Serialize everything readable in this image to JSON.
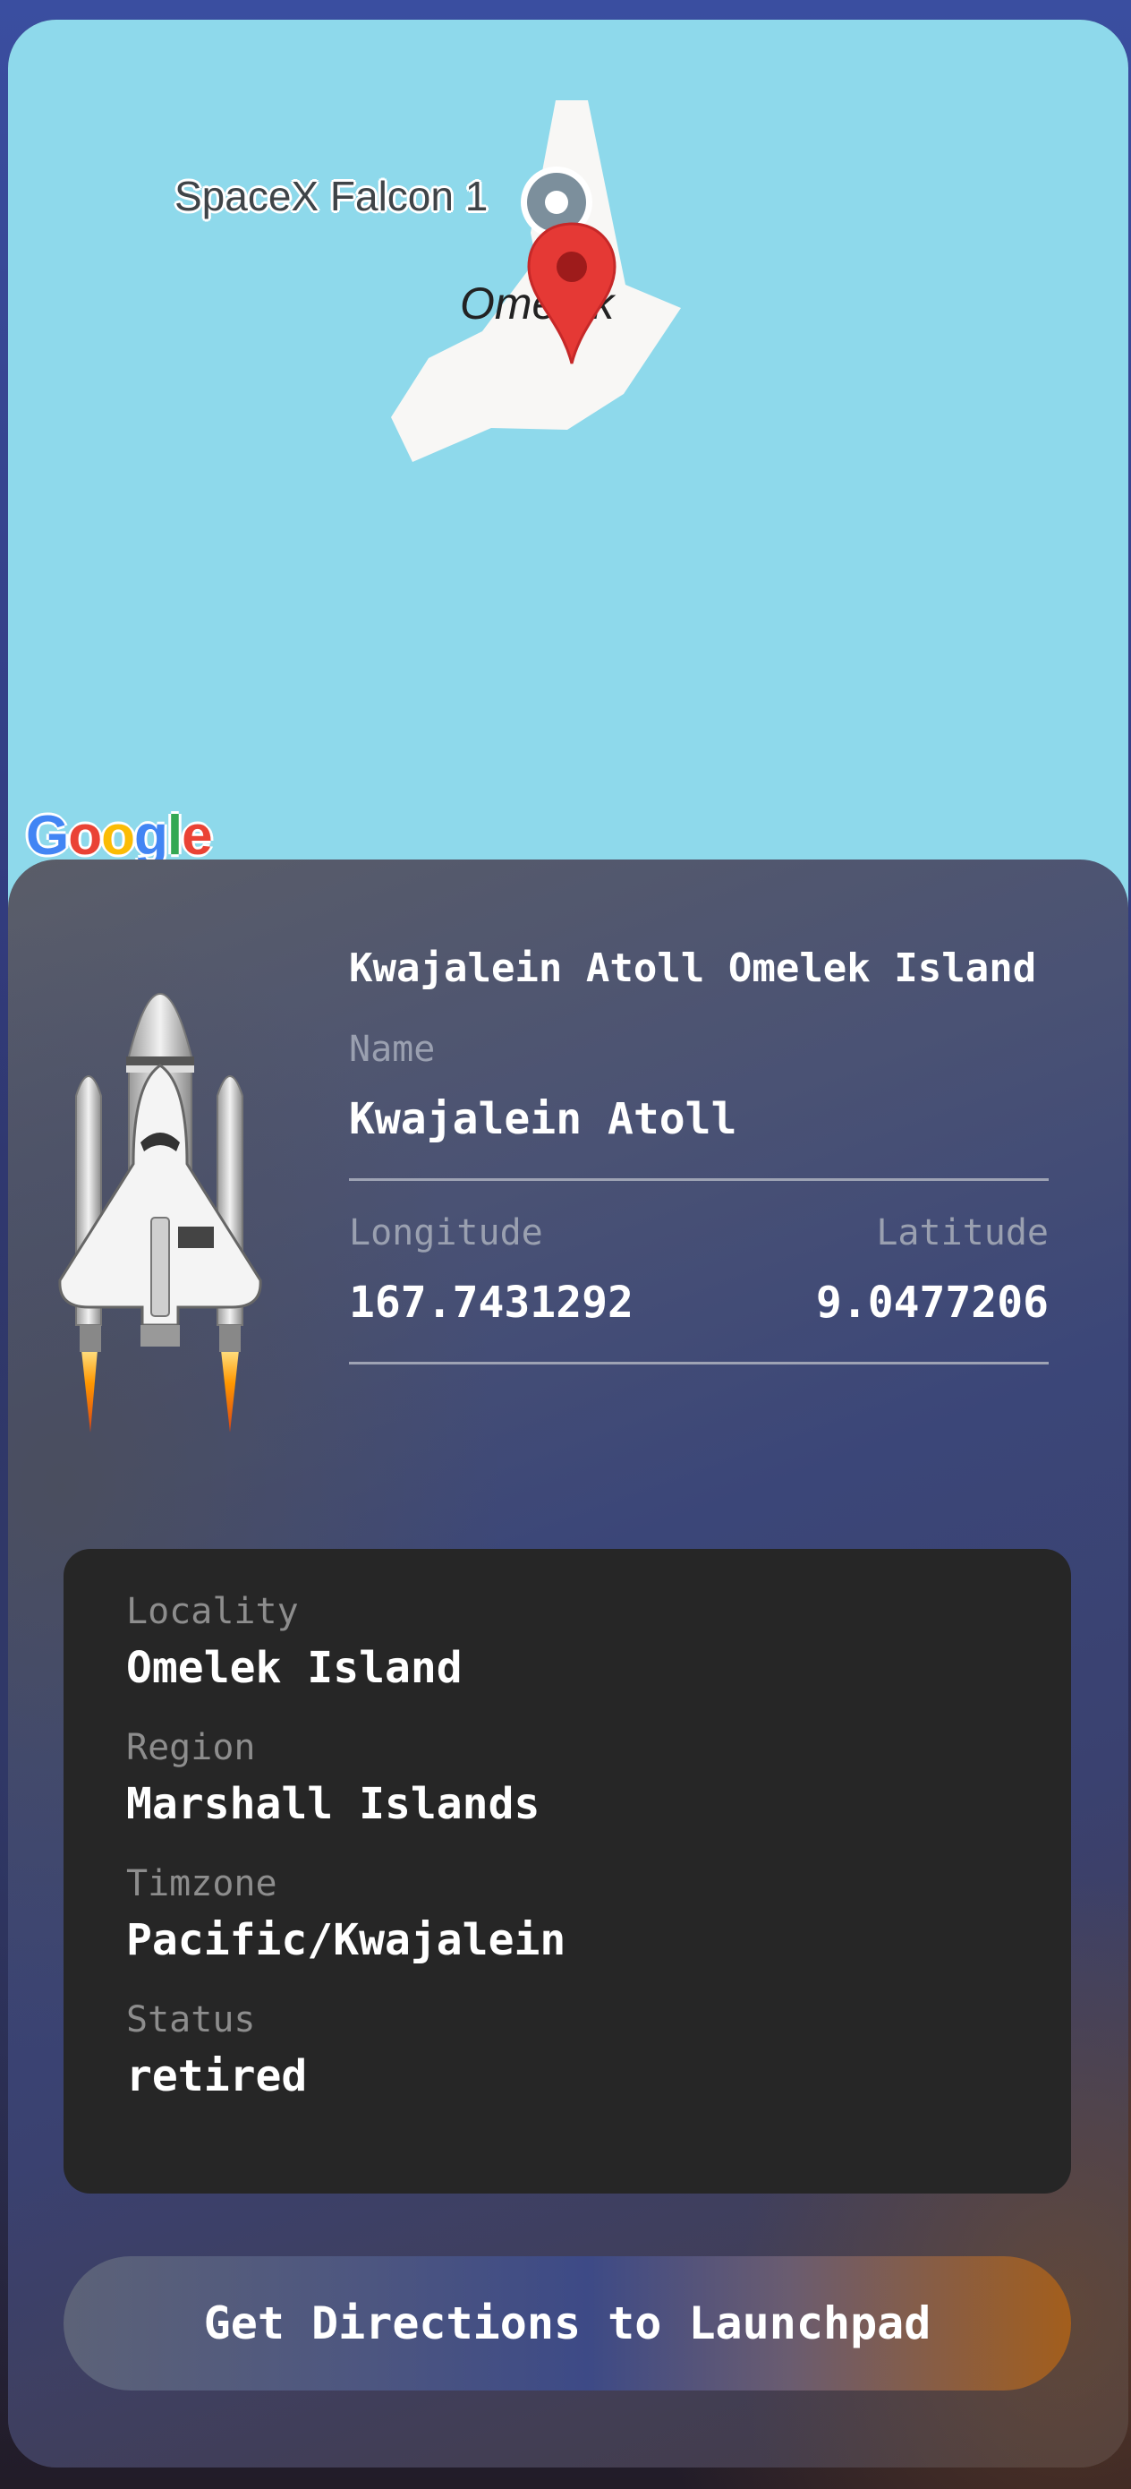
{
  "map": {
    "poi_label": "SpaceX Falcon 1",
    "island_label": "Omelek",
    "logo": "Google"
  },
  "launchpad": {
    "full_name": "Kwajalein Atoll Omelek Island",
    "name_label": "Name",
    "name": "Kwajalein Atoll",
    "longitude_label": "Longitude",
    "longitude": "167.7431292",
    "latitude_label": "Latitude",
    "latitude": "9.0477206"
  },
  "details": {
    "locality_label": "Locality",
    "locality": "Omelek Island",
    "region_label": "Region",
    "region": "Marshall Islands",
    "timezone_label": "Timzone",
    "timezone": "Pacific/Kwajalein",
    "status_label": "Status",
    "status": "retired"
  },
  "cta": {
    "label": "Get Directions to Launchpad"
  },
  "colors": {
    "water": "#8ed9eb",
    "land": "#f8f7f5",
    "pin": "#e53935",
    "details_bg": "#262626",
    "cta_end": "#a35e1c"
  },
  "icons": {
    "poi": "poi-marker-icon",
    "pin": "map-pin-icon",
    "rocket": "space-shuttle-icon"
  }
}
